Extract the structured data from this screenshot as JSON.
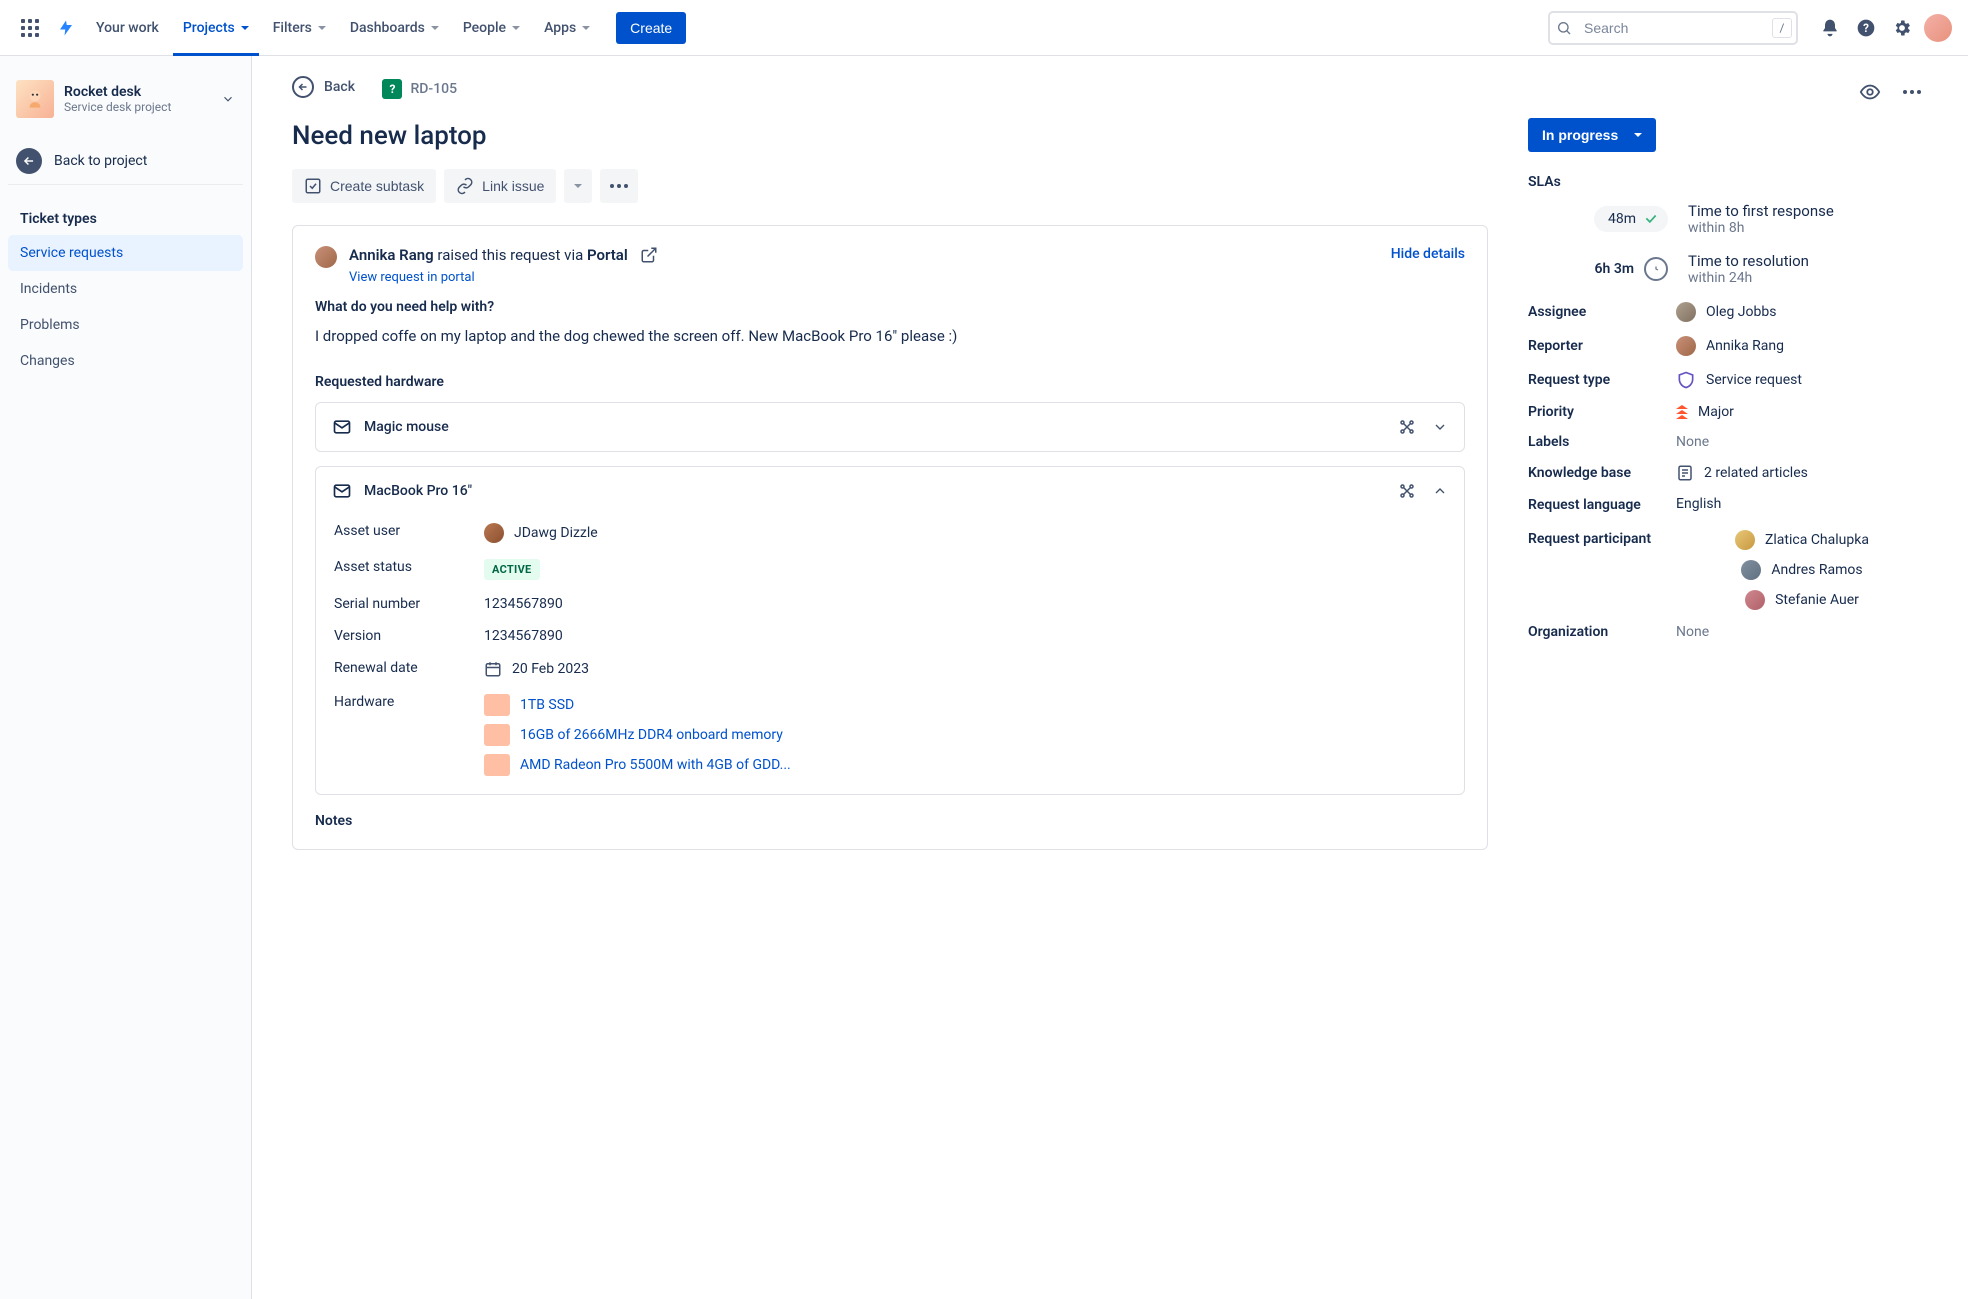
{
  "nav": {
    "your_work": "Your work",
    "projects": "Projects",
    "filters": "Filters",
    "dashboards": "Dashboards",
    "people": "People",
    "apps": "Apps",
    "create": "Create",
    "search_placeholder": "Search",
    "slash": "/"
  },
  "sidebar": {
    "project_name": "Rocket desk",
    "project_type": "Service desk project",
    "back_to_project": "Back to project",
    "group_header": "Ticket types",
    "items": [
      {
        "label": "Service requests"
      },
      {
        "label": "Incidents"
      },
      {
        "label": "Problems"
      },
      {
        "label": "Changes"
      }
    ]
  },
  "issue": {
    "back": "Back",
    "key": "RD-105",
    "title": "Need new laptop",
    "create_subtask": "Create subtask",
    "link_issue": "Link issue",
    "raised_by": "Annika Rang",
    "raised_middle": " raised this request via ",
    "raised_via": "Portal",
    "view_in_portal": "View request in portal",
    "hide_details": "Hide details",
    "question_label": "What do you need help with?",
    "question_body": "I dropped coffe on my laptop and the dog chewed the screen off. New MacBook Pro 16\" please :)",
    "req_hw_label": "Requested hardware",
    "hw": [
      {
        "name": "Magic mouse",
        "expanded": false
      },
      {
        "name": "MacBook Pro 16\"",
        "expanded": true
      }
    ],
    "details": {
      "asset_user_k": "Asset user",
      "asset_user_v": "JDawg Dizzle",
      "asset_status_k": "Asset status",
      "asset_status_v": "ACTIVE",
      "serial_k": "Serial number",
      "serial_v": "1234567890",
      "version_k": "Version",
      "version_v": "1234567890",
      "renewal_k": "Renewal date",
      "renewal_v": "20 Feb 2023",
      "hardware_k": "Hardware",
      "hardware_items": [
        "1TB SSD",
        "16GB of 2666MHz DDR4 onboard memory",
        "AMD Radeon Pro 5500M with 4GB of GDD..."
      ]
    },
    "notes": "Notes"
  },
  "right": {
    "status": "In progress",
    "slas_h": "SLAs",
    "sla1_time": "48m",
    "sla1_desc": "Time to first response",
    "sla1_sub": "within 8h",
    "sla2_time": "6h 3m",
    "sla2_desc": "Time to resolution",
    "sla2_sub": "within 24h",
    "assignee_k": "Assignee",
    "assignee_v": "Oleg Jobbs",
    "reporter_k": "Reporter",
    "reporter_v": "Annika Rang",
    "req_type_k": "Request type",
    "req_type_v": "Service request",
    "priority_k": "Priority",
    "priority_v": "Major",
    "labels_k": "Labels",
    "labels_v": "None",
    "kb_k": "Knowledge base",
    "kb_v": "2 related articles",
    "req_lang_k": "Request language",
    "req_lang_v": "English",
    "req_part_k": "Request participant",
    "participants": [
      "Zlatica Chalupka",
      "Andres Ramos",
      "Stefanie Auer"
    ],
    "org_k": "Organization",
    "org_v": "None"
  }
}
